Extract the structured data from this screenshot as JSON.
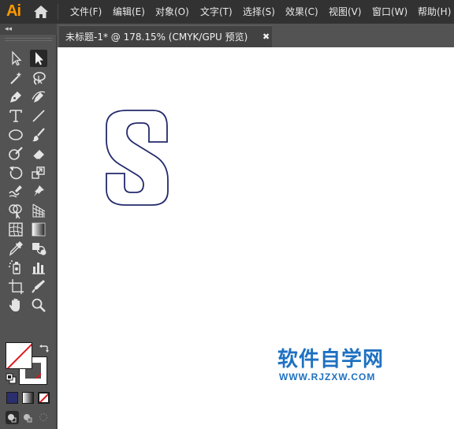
{
  "app": {
    "logo_text": "Ai"
  },
  "menu": [
    "文件(F)",
    "编辑(E)",
    "对象(O)",
    "文字(T)",
    "选择(S)",
    "效果(C)",
    "视图(V)",
    "窗口(W)",
    "帮助(H)"
  ],
  "toolbar": {
    "collapse_label": "◂◂",
    "tools": [
      {
        "name": "selection-tool",
        "icon": "selection-arrow-icon",
        "active": false
      },
      {
        "name": "direct-selection-tool",
        "icon": "direct-selection-icon",
        "active": true
      },
      {
        "name": "magic-wand-tool",
        "icon": "magic-wand-icon"
      },
      {
        "name": "lasso-tool",
        "icon": "lasso-icon"
      },
      {
        "name": "pen-tool",
        "icon": "pen-icon"
      },
      {
        "name": "curvature-tool",
        "icon": "curvature-icon"
      },
      {
        "name": "type-tool",
        "icon": "type-icon"
      },
      {
        "name": "line-tool",
        "icon": "line-segment-icon"
      },
      {
        "name": "ellipse-tool",
        "icon": "ellipse-icon"
      },
      {
        "name": "paintbrush-tool",
        "icon": "paintbrush-icon"
      },
      {
        "name": "blob-brush-tool",
        "icon": "blob-brush-icon"
      },
      {
        "name": "eraser-tool",
        "icon": "eraser-icon"
      },
      {
        "name": "rotate-tool",
        "icon": "rotate-icon"
      },
      {
        "name": "scale-tool",
        "icon": "scale-icon"
      },
      {
        "name": "warp-tool",
        "icon": "warp-icon"
      },
      {
        "name": "puppet-warp-tool",
        "icon": "pin-icon"
      },
      {
        "name": "shape-builder-tool",
        "icon": "shape-builder-icon"
      },
      {
        "name": "perspective-grid-tool",
        "icon": "perspective-grid-icon"
      },
      {
        "name": "mesh-tool",
        "icon": "mesh-icon"
      },
      {
        "name": "gradient-tool",
        "icon": "gradient-icon"
      },
      {
        "name": "eyedropper-tool",
        "icon": "eyedropper-icon"
      },
      {
        "name": "blend-tool",
        "icon": "blend-icon"
      },
      {
        "name": "symbol-sprayer-tool",
        "icon": "symbol-sprayer-icon"
      },
      {
        "name": "column-graph-tool",
        "icon": "column-graph-icon"
      },
      {
        "name": "artboard-tool",
        "icon": "artboard-icon"
      },
      {
        "name": "slice-tool",
        "icon": "slice-knife-icon"
      },
      {
        "name": "hand-tool",
        "icon": "hand-icon"
      },
      {
        "name": "zoom-tool",
        "icon": "magnifier-icon"
      }
    ],
    "fill_color": "#ffffff",
    "stroke_color": "none",
    "mode_color_swatch": "#2b2f6e"
  },
  "document": {
    "tab_label": "未标题-1* @ 178.15% (CMYK/GPU 预览)",
    "close_glyph": "✖",
    "letter_stroke": "#232a6b"
  },
  "watermark": {
    "title": "软件自学网",
    "url": "WWW.RJZXW.COM",
    "color": "#1e71c2"
  }
}
